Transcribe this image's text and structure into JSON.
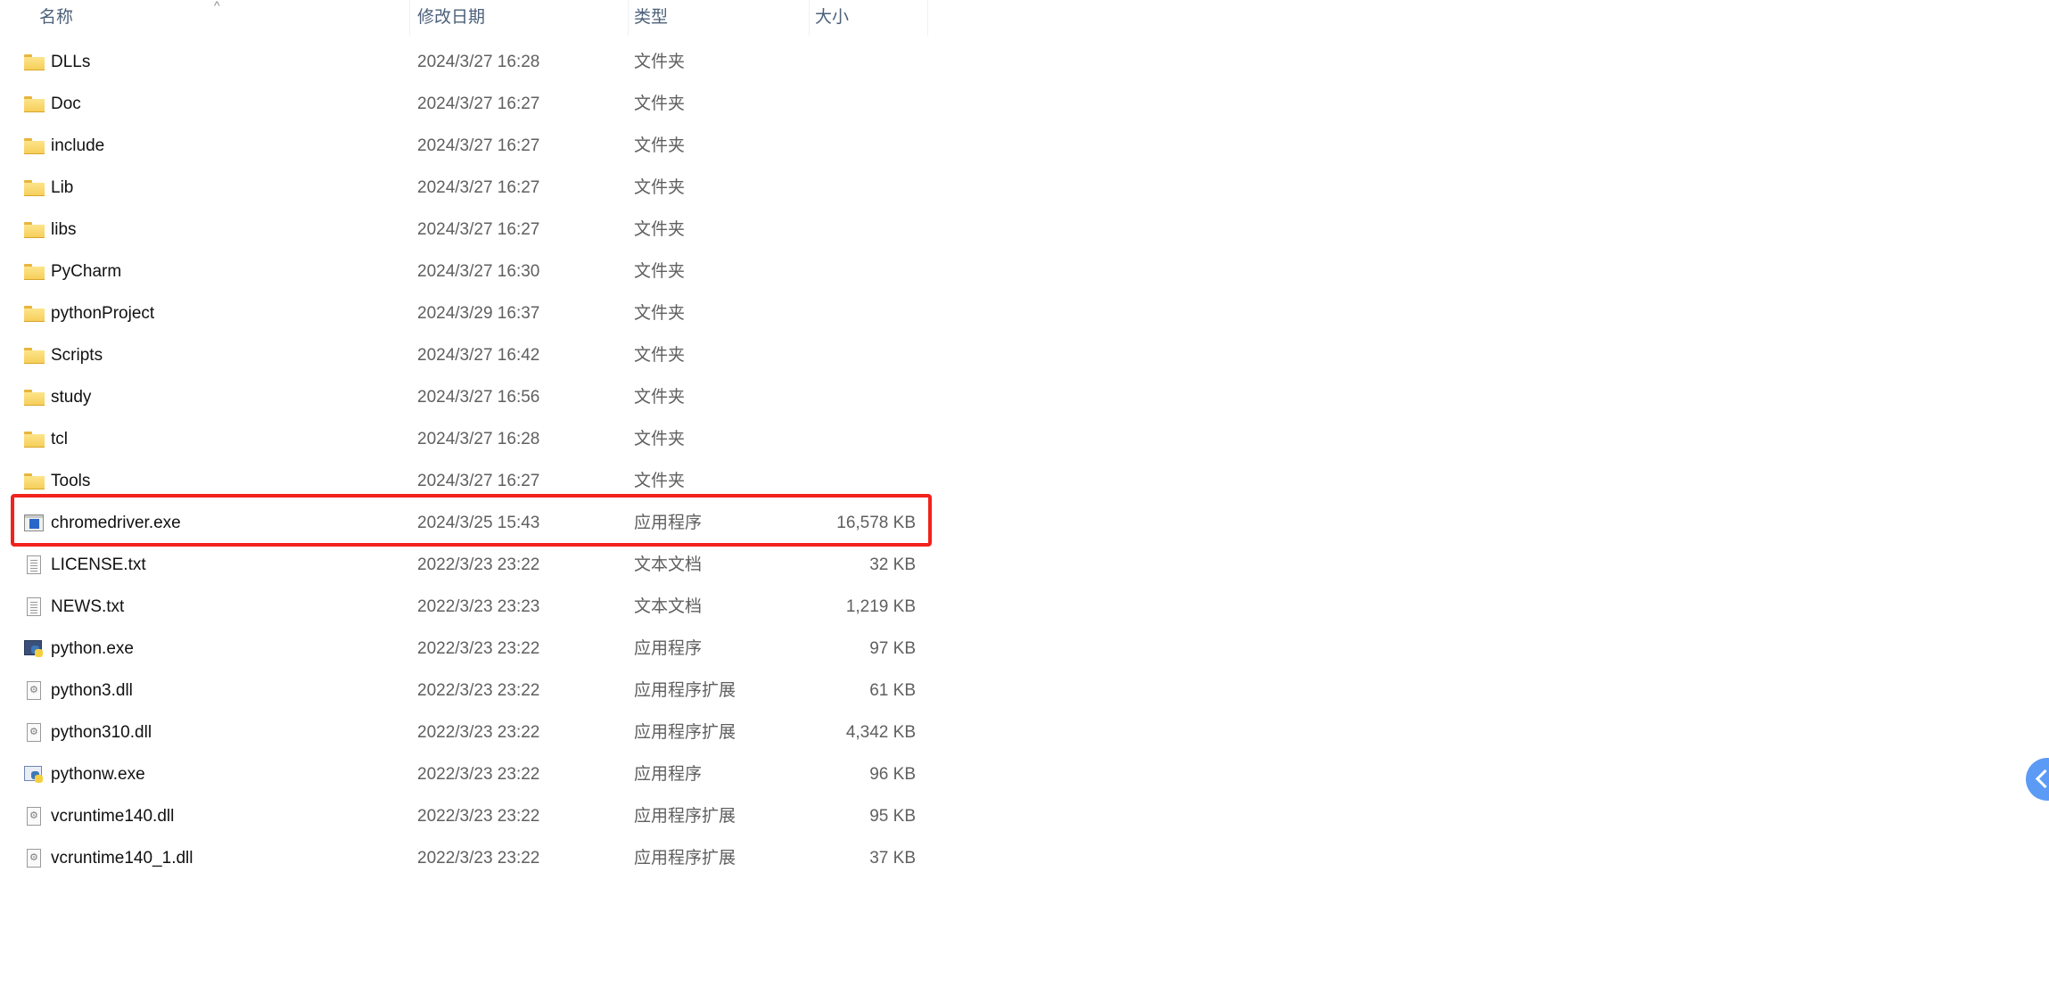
{
  "header": {
    "columns": [
      {
        "label": "名称"
      },
      {
        "label": "修改日期"
      },
      {
        "label": "类型"
      },
      {
        "label": "大小"
      }
    ],
    "sort_indicator": "^"
  },
  "files": [
    {
      "name": "DLLs",
      "date": "2024/3/27 16:28",
      "type": "文件夹",
      "size": "",
      "icon": "folder-icon"
    },
    {
      "name": "Doc",
      "date": "2024/3/27 16:27",
      "type": "文件夹",
      "size": "",
      "icon": "folder-icon"
    },
    {
      "name": "include",
      "date": "2024/3/27 16:27",
      "type": "文件夹",
      "size": "",
      "icon": "folder-icon"
    },
    {
      "name": "Lib",
      "date": "2024/3/27 16:27",
      "type": "文件夹",
      "size": "",
      "icon": "folder-icon"
    },
    {
      "name": "libs",
      "date": "2024/3/27 16:27",
      "type": "文件夹",
      "size": "",
      "icon": "folder-icon"
    },
    {
      "name": "PyCharm",
      "date": "2024/3/27 16:30",
      "type": "文件夹",
      "size": "",
      "icon": "folder-icon"
    },
    {
      "name": "pythonProject",
      "date": "2024/3/29 16:37",
      "type": "文件夹",
      "size": "",
      "icon": "folder-icon"
    },
    {
      "name": "Scripts",
      "date": "2024/3/27 16:42",
      "type": "文件夹",
      "size": "",
      "icon": "folder-icon"
    },
    {
      "name": "study",
      "date": "2024/3/27 16:56",
      "type": "文件夹",
      "size": "",
      "icon": "folder-icon"
    },
    {
      "name": "tcl",
      "date": "2024/3/27 16:28",
      "type": "文件夹",
      "size": "",
      "icon": "folder-icon"
    },
    {
      "name": "Tools",
      "date": "2024/3/27 16:27",
      "type": "文件夹",
      "size": "",
      "icon": "folder-icon"
    },
    {
      "name": "chromedriver.exe",
      "date": "2024/3/25 15:43",
      "type": "应用程序",
      "size": "16,578 KB",
      "icon": "application-icon",
      "highlighted": true
    },
    {
      "name": "LICENSE.txt",
      "date": "2022/3/23 23:22",
      "type": "文本文档",
      "size": "32 KB",
      "icon": "text-document-icon"
    },
    {
      "name": "NEWS.txt",
      "date": "2022/3/23 23:23",
      "type": "文本文档",
      "size": "1,219 KB",
      "icon": "text-document-icon"
    },
    {
      "name": "python.exe",
      "date": "2022/3/23 23:22",
      "type": "应用程序",
      "size": "97 KB",
      "icon": "python-icon"
    },
    {
      "name": "python3.dll",
      "date": "2022/3/23 23:22",
      "type": "应用程序扩展",
      "size": "61 KB",
      "icon": "dll-icon"
    },
    {
      "name": "python310.dll",
      "date": "2022/3/23 23:22",
      "type": "应用程序扩展",
      "size": "4,342 KB",
      "icon": "dll-icon"
    },
    {
      "name": "pythonw.exe",
      "date": "2022/3/23 23:22",
      "type": "应用程序",
      "size": "96 KB",
      "icon": "pythonw-icon"
    },
    {
      "name": "vcruntime140.dll",
      "date": "2022/3/23 23:22",
      "type": "应用程序扩展",
      "size": "95 KB",
      "icon": "dll-icon"
    },
    {
      "name": "vcruntime140_1.dll",
      "date": "2022/3/23 23:22",
      "type": "应用程序扩展",
      "size": "37 KB",
      "icon": "dll-icon"
    }
  ],
  "highlight_color": "#f2221c",
  "floating_button": {
    "icon": "chevron-left-icon",
    "color": "#5b9bf5"
  }
}
